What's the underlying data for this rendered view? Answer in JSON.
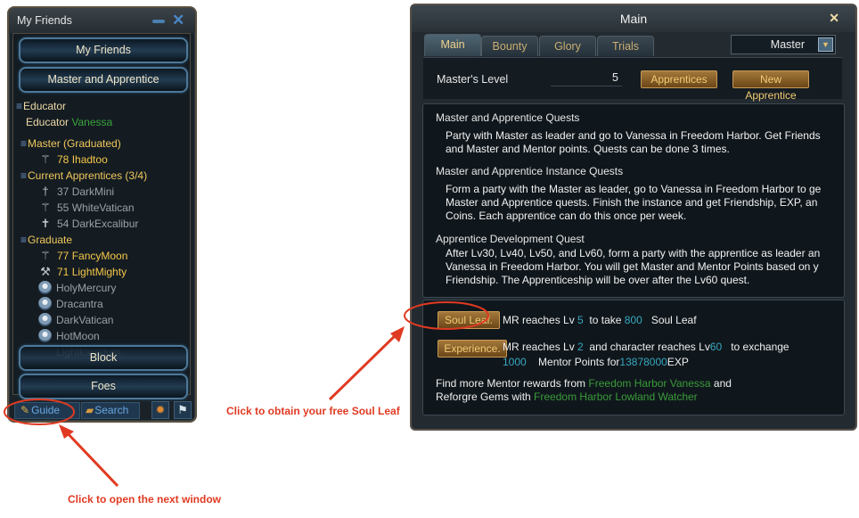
{
  "friends_window": {
    "title": "My Friends",
    "minimize_icon": "minimize-icon",
    "close_icon": "close-x-icon",
    "nav": {
      "my_friends": "My Friends",
      "master_apprentice": "Master and Apprentice"
    },
    "educator": {
      "header": "Educator",
      "label": "Educator",
      "name": "Vanessa"
    },
    "master_graduated": {
      "header": "Master (Graduated)",
      "members": [
        {
          "level": "78",
          "name": "Ihadtoo"
        }
      ]
    },
    "current_apprentices": {
      "header": "Current Apprentices (3/4)",
      "members": [
        {
          "level": "37",
          "name": "DarkMini"
        },
        {
          "level": "55",
          "name": "WhiteVatican"
        },
        {
          "level": "54",
          "name": "DarkExcalibur"
        }
      ]
    },
    "graduate": {
      "header": "Graduate",
      "members": [
        {
          "level": "77",
          "name": "FancyMoon",
          "online": true
        },
        {
          "level": "71",
          "name": "LightMighty",
          "online": true
        },
        {
          "level": "",
          "name": "HolyMercury",
          "online": false
        },
        {
          "level": "",
          "name": "Dracantra",
          "online": false
        },
        {
          "level": "",
          "name": "DarkVatican",
          "online": false
        },
        {
          "level": "",
          "name": "HotMoon",
          "online": false
        },
        {
          "level": "",
          "name": "Lightkaragum",
          "online": false
        }
      ]
    },
    "block_label": "Block",
    "foes_label": "Foes",
    "footer": {
      "guide": "Guide",
      "search": "Search",
      "settings_icon": "gear-icon",
      "flag_icon": "flag-icon"
    }
  },
  "main_window": {
    "title": "Main",
    "tabs": [
      {
        "label": "Main",
        "active": true
      },
      {
        "label": "Bounty"
      },
      {
        "label": "Glory"
      },
      {
        "label": "Trials"
      }
    ],
    "role_select": {
      "value": "Master"
    },
    "masters_level_label": "Master's Level",
    "masters_level_value": "5",
    "apprentices_button": "Apprentices",
    "new_apprentice_button": "New Apprentice",
    "sections": [
      {
        "heading": "Master and Apprentice Quests",
        "lines": [
          "Party with Master as leader and go to Vanessa in Freedom Harbor. Get Friends",
          "and Master and Mentor points. Quests can be done 3 times."
        ]
      },
      {
        "heading": "Master and Apprentice Instance Quests",
        "lines": [
          "Form a party with the Master as leader, go to Vanessa in Freedom Harbor to ge",
          "Master and Apprentice quests. Finish the instance and get Friendship, EXP, an",
          "Coins. Each apprentice can do this once per week."
        ]
      },
      {
        "heading": "Apprentice Development Quest",
        "lines": [
          "After Lv30, Lv40, Lv50, and Lv60, form a party with the apprentice as leader an",
          "Vanessa in Freedom Harbor. You will get Master and Mentor Points based on y",
          "Friendship. The Apprenticeship will be over after the Lv60 quest."
        ]
      }
    ],
    "rewards": {
      "soul_leaf_button": "Soul Leaf.",
      "soul_leaf_text": {
        "a": "MR reaches Lv",
        "lv": "5",
        "b": "to take",
        "amount": "800",
        "c": "Soul Leaf"
      },
      "experience_button": "Experience.",
      "experience_text": {
        "a": "MR reaches Lv",
        "mr_lv": "2",
        "b": "and character reaches Lv",
        "char_lv": "60",
        "c": "to exchange",
        "points": "1000",
        "d": "Mentor Points for",
        "exp": "13878000",
        "e": "EXP"
      },
      "more": {
        "a": "Find more Mentor rewards from",
        "npc1": "Freedom Harbor Vanessa",
        "b": "and",
        "c": "Reforgre Gems with",
        "npc2": "Freedom Harbor Lowland Watcher"
      }
    }
  },
  "annotations": {
    "soul_leaf_hint": "Click to obtain your free Soul Leaf",
    "guide_hint": "Click to open the next window",
    "highlight_color": "#e03a22"
  }
}
